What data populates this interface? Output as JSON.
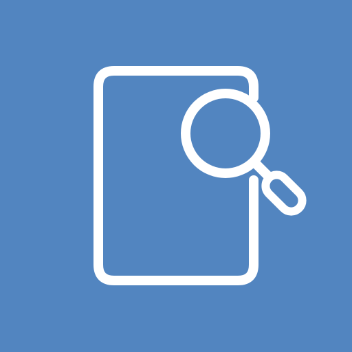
{
  "icon": {
    "name": "document-search-icon",
    "colors": {
      "background": "#5285c0",
      "foreground": "#ffffff"
    }
  }
}
